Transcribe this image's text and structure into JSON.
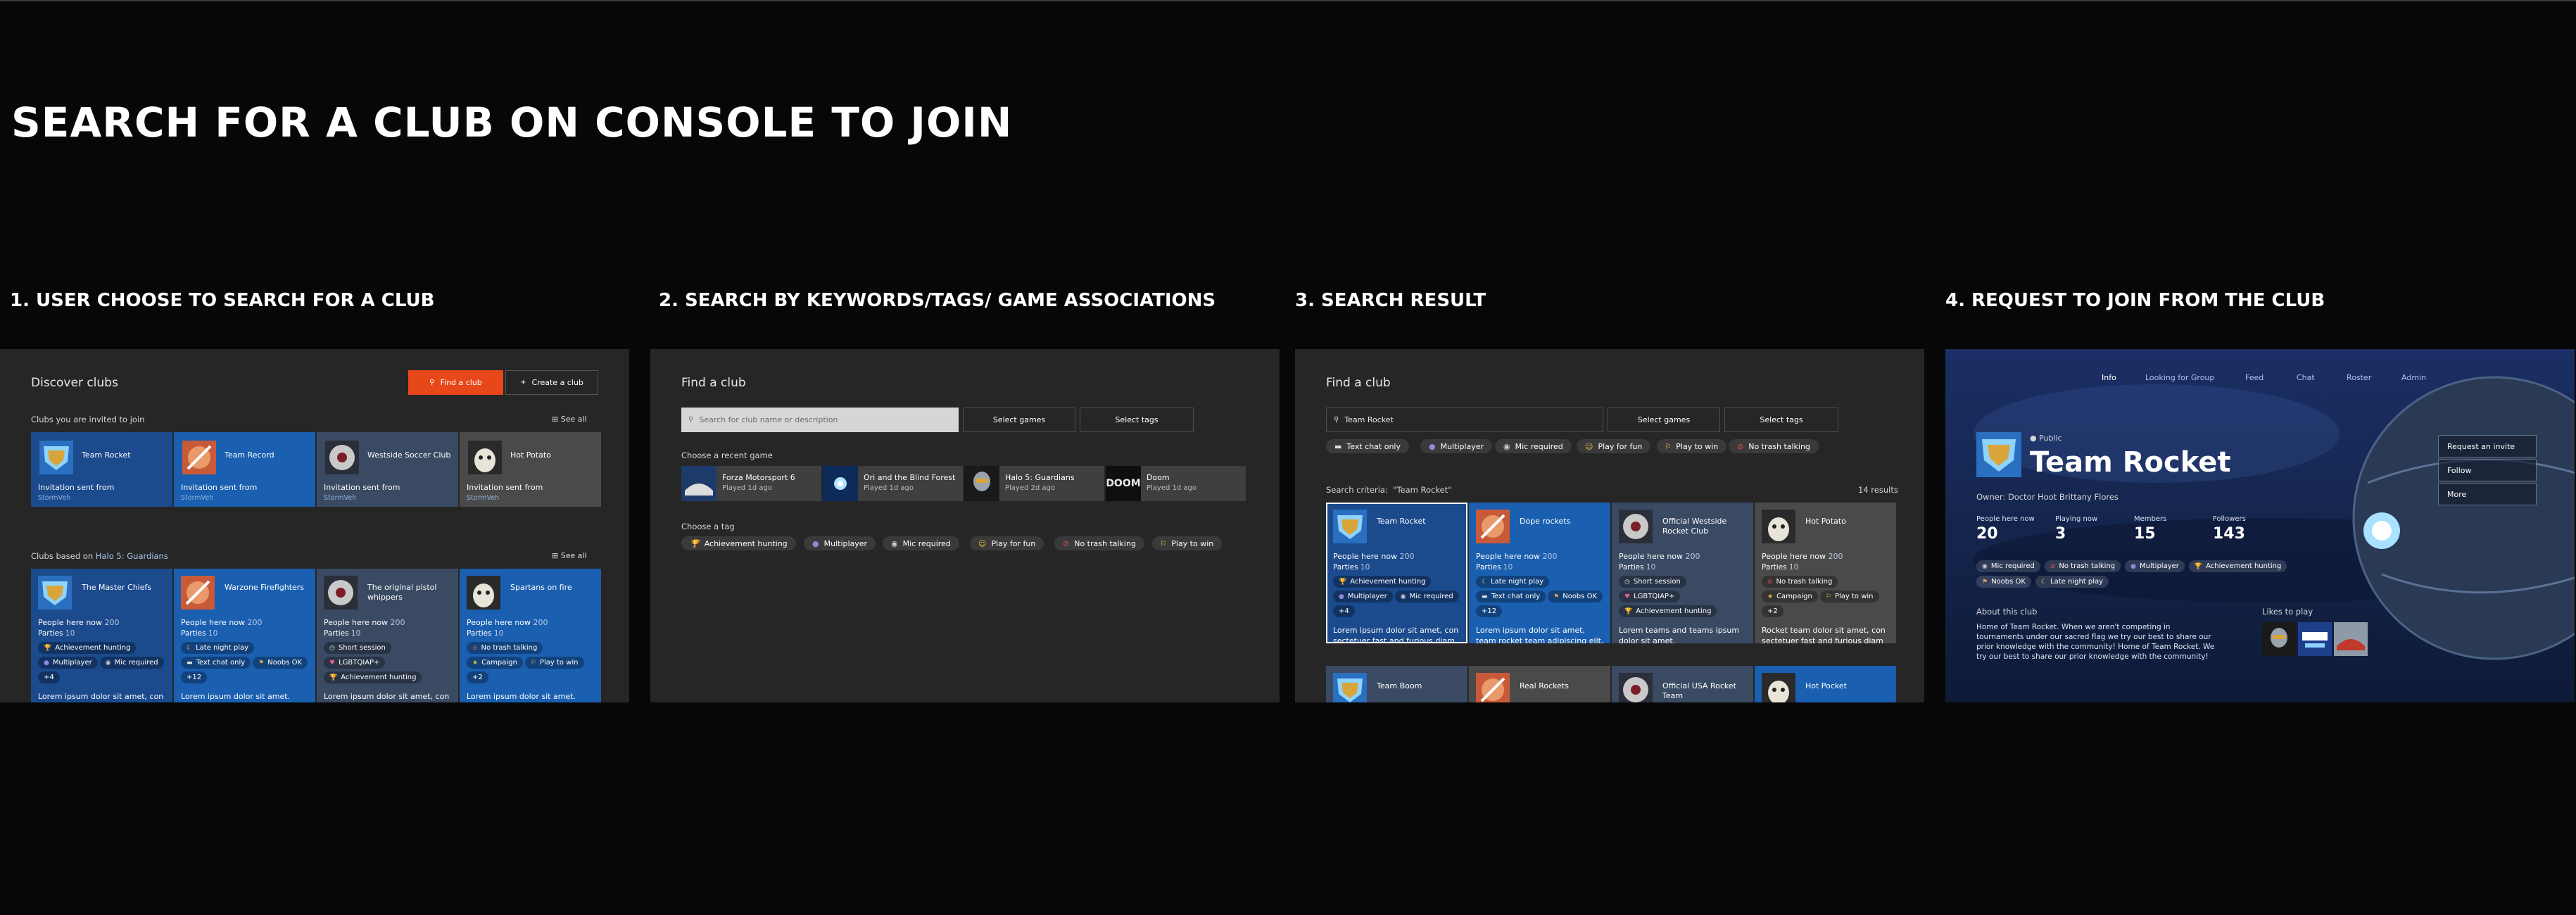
{
  "main_title": "SEARCH FOR A CLUB ON CONSOLE TO JOIN",
  "steps": [
    {
      "title": "1. USER CHOOSE TO SEARCH FOR A CLUB"
    },
    {
      "title": "2. SEARCH BY KEYWORDS/TAGS/ GAME ASSOCIATIONS"
    },
    {
      "title": "3. SEARCH RESULT"
    },
    {
      "title": "4. REQUEST TO JOIN FROM THE CLUB"
    }
  ],
  "colors": {
    "accent_orange": "#e8471a",
    "club_blue": "#1b4a8d",
    "club_blue_alt": "#1a5fb0",
    "club_slate": "#3a4a63",
    "club_gray": "#4a4a4a",
    "page_bg": "#070707",
    "panel_bg": "#262626"
  },
  "p1": {
    "title": "Discover clubs",
    "find_button": "Find a club",
    "find_icon": "search-icon",
    "create_button": "Create a club",
    "create_icon": "plus-icon",
    "invited_label": "Clubs you are invited to join",
    "see_all": "See all",
    "invited": [
      {
        "name": "Team Rocket",
        "l1": "Invitation sent from",
        "l2": "StormVeh",
        "logo": "rocket-league-logo"
      },
      {
        "name": "Team Record",
        "l1": "Invitation sent from",
        "l2": "StormVeh",
        "logo": "firefighter-logo"
      },
      {
        "name": "Westside Soccer Club",
        "l1": "Invitation sent from",
        "l2": "StormVeh",
        "logo": "soccer-logo"
      },
      {
        "name": "Hot Potato",
        "l1": "Invitation sent from",
        "l2": "StormVeh",
        "logo": "potato-logo"
      }
    ],
    "based_prefix": "Clubs based on ",
    "based_game": "Halo 5: Guardians",
    "clubs": [
      {
        "name": "The Master Chiefs",
        "ppl": "People here now",
        "ppl_n": "200",
        "par": "Parties",
        "par_n": "10",
        "tags": [
          {
            "icon": "trophy-icon",
            "t": "Achievement hunting"
          },
          {
            "icon": "controller-icon",
            "t": "Multiplayer"
          },
          {
            "icon": "mic-icon",
            "t": "Mic required"
          },
          {
            "icon": "",
            "t": "+4"
          }
        ],
        "desc": "Lorem ipsum dolor sit amet, con"
      },
      {
        "name": "Warzone Firefighters",
        "ppl": "People here now",
        "ppl_n": "200",
        "par": "Parties",
        "par_n": "10",
        "tags": [
          {
            "icon": "moon-icon",
            "t": "Late night play"
          },
          {
            "icon": "chat-icon",
            "t": "Text chat only"
          },
          {
            "icon": "flag-icon",
            "t": "Noobs OK"
          },
          {
            "icon": "",
            "t": "+12"
          }
        ],
        "desc": "Lorem ipsum dolor sit amet."
      },
      {
        "name": "The original pistol whippers",
        "ppl": "People here now",
        "ppl_n": "200",
        "par": "Parties",
        "par_n": "10",
        "tags": [
          {
            "icon": "clock-icon",
            "t": "Short session"
          },
          {
            "icon": "lgbt-icon",
            "t": "LGBTQIAP+"
          },
          {
            "icon": "trophy-icon",
            "t": "Achievement hunting"
          }
        ],
        "desc": "Lorem ipsum dolor sit amet, con"
      },
      {
        "name": "Spartans on fire",
        "ppl": "People here now",
        "ppl_n": "200",
        "par": "Parties",
        "par_n": "10",
        "tags": [
          {
            "icon": "no-talk-icon",
            "t": "No trash talking"
          },
          {
            "icon": "campaign-icon",
            "t": "Campaign"
          },
          {
            "icon": "win-icon",
            "t": "Play to win"
          },
          {
            "icon": "",
            "t": "+2"
          }
        ],
        "desc": "Lorem ipsum dolor sit amet."
      }
    ]
  },
  "p2": {
    "title": "Find a club",
    "search_placeholder": "Search for club name or description",
    "select_games": "Select games",
    "select_tags": "Select tags",
    "recent_label": "Choose a recent game",
    "games": [
      {
        "t": "Forza Motorsport 6",
        "s": "Played 1d ago"
      },
      {
        "t": "Ori and the Blind Forest",
        "s": "Played 1d ago"
      },
      {
        "t": "Halo 5: Guardians",
        "s": "Played 2d ago"
      },
      {
        "t": "Doom",
        "s": "Played 1d ago",
        "logo_text": "DOOM"
      }
    ],
    "tag_label": "Choose a tag",
    "tags": [
      {
        "icon": "trophy-icon",
        "t": "Achievement hunting"
      },
      {
        "icon": "controller-icon",
        "t": "Multiplayer"
      },
      {
        "icon": "mic-icon",
        "t": "Mic required"
      },
      {
        "icon": "fun-icon",
        "t": "Play for fun"
      },
      {
        "icon": "no-talk-icon",
        "t": "No trash talking"
      },
      {
        "icon": "win-icon",
        "t": "Play to win"
      }
    ]
  },
  "p3": {
    "title": "Find a club",
    "search_value": "Team Rocket",
    "select_games": "Select games",
    "select_tags": "Select tags",
    "filters": [
      {
        "icon": "chat-icon",
        "t": "Text chat only"
      },
      {
        "icon": "controller-icon",
        "t": "Multiplayer"
      },
      {
        "icon": "mic-icon",
        "t": "Mic required"
      },
      {
        "icon": "fun-icon",
        "t": "Play for fun"
      },
      {
        "icon": "win-icon",
        "t": "Play to win"
      },
      {
        "icon": "no-talk-icon",
        "t": "No trash talking"
      }
    ],
    "criteria_label": "Search criteria:",
    "criteria_value": "\"Team Rocket\"",
    "results": "14 results",
    "clubs": [
      {
        "name": "Team Rocket",
        "ppl": "People here now",
        "ppl_n": "200",
        "par": "Parties",
        "par_n": "10",
        "tags": [
          {
            "icon": "trophy-icon",
            "t": "Achievement hunting"
          },
          {
            "icon": "controller-icon",
            "t": "Multiplayer"
          },
          {
            "icon": "mic-icon",
            "t": "Mic required"
          },
          {
            "icon": "",
            "t": "+4"
          }
        ],
        "desc": "Lorem ipsum dolor sit amet, con sectetuer fast and furious diam adipiscing elit, sed diam nonumm..."
      },
      {
        "name": "Dope rockets",
        "ppl": "People here now",
        "ppl_n": "200",
        "par": "Parties",
        "par_n": "10",
        "tags": [
          {
            "icon": "moon-icon",
            "t": "Late night play"
          },
          {
            "icon": "chat-icon",
            "t": "Text chat only"
          },
          {
            "icon": "flag-icon",
            "t": "Noobs OK"
          },
          {
            "icon": "",
            "t": "+12"
          }
        ],
        "desc": "Lorem ipsum dolor sit amet, team rocket team adipiscing elit, sed nonummy nibh euismod erat."
      },
      {
        "name": "Official Westside Rocket Club",
        "ppl": "People here now",
        "ppl_n": "200",
        "par": "Parties",
        "par_n": "10",
        "tags": [
          {
            "icon": "clock-icon",
            "t": "Short session"
          },
          {
            "icon": "lgbt-icon",
            "t": "LGBTQIAP+"
          },
          {
            "icon": "trophy-icon",
            "t": "Achievement hunting"
          }
        ],
        "desc": "Lorem teams and teams ipsum dolor sit amet."
      },
      {
        "name": "Hot Potato",
        "ppl": "People here now",
        "ppl_n": "200",
        "par": "Parties",
        "par_n": "10",
        "tags": [
          {
            "icon": "no-talk-icon",
            "t": "No trash talking"
          },
          {
            "icon": "campaign-icon",
            "t": "Campaign"
          },
          {
            "icon": "win-icon",
            "t": "Play to win"
          },
          {
            "icon": "",
            "t": "+2"
          }
        ],
        "desc": "Rocket team dolor sit amet, con sectetuer fast and furious diam adipiscing elit, sed diam nonum"
      }
    ],
    "row2": [
      "Team Boom",
      "Real Rockets",
      "Official USA Rocket Team",
      "Hot Pocket"
    ]
  },
  "p4": {
    "nav": [
      "Info",
      "Looking for Group",
      "Feed",
      "Chat",
      "Roster",
      "Admin"
    ],
    "public_label": "Public",
    "club_name": "Team Rocket",
    "owner": "Owner: Doctor Hoot Brittany Flores",
    "stats": [
      {
        "l": "People here now",
        "v": "20"
      },
      {
        "l": "Playing now",
        "v": "3"
      },
      {
        "l": "Members",
        "v": "15"
      },
      {
        "l": "Followers",
        "v": "143"
      }
    ],
    "tags": [
      {
        "icon": "mic-icon",
        "t": "Mic required"
      },
      {
        "icon": "no-talk-icon",
        "t": "No trash talking"
      },
      {
        "icon": "controller-icon",
        "t": "Multiplayer"
      },
      {
        "icon": "trophy-icon",
        "t": "Achievement hunting"
      },
      {
        "icon": "flag-icon",
        "t": "Noobs OK"
      },
      {
        "icon": "moon-icon",
        "t": "Late night play"
      }
    ],
    "about_label": "About this club",
    "about": "Home of Team Rocket. When we aren't competing in tournaments under our sacred flag we try our best to share our prior knowledge with the community! Home of Team Rocket. We try our best to share our prior knowledge with the community!",
    "likes_label": "Likes to play",
    "menu": [
      "Request an invite",
      "Follow",
      "More"
    ]
  }
}
